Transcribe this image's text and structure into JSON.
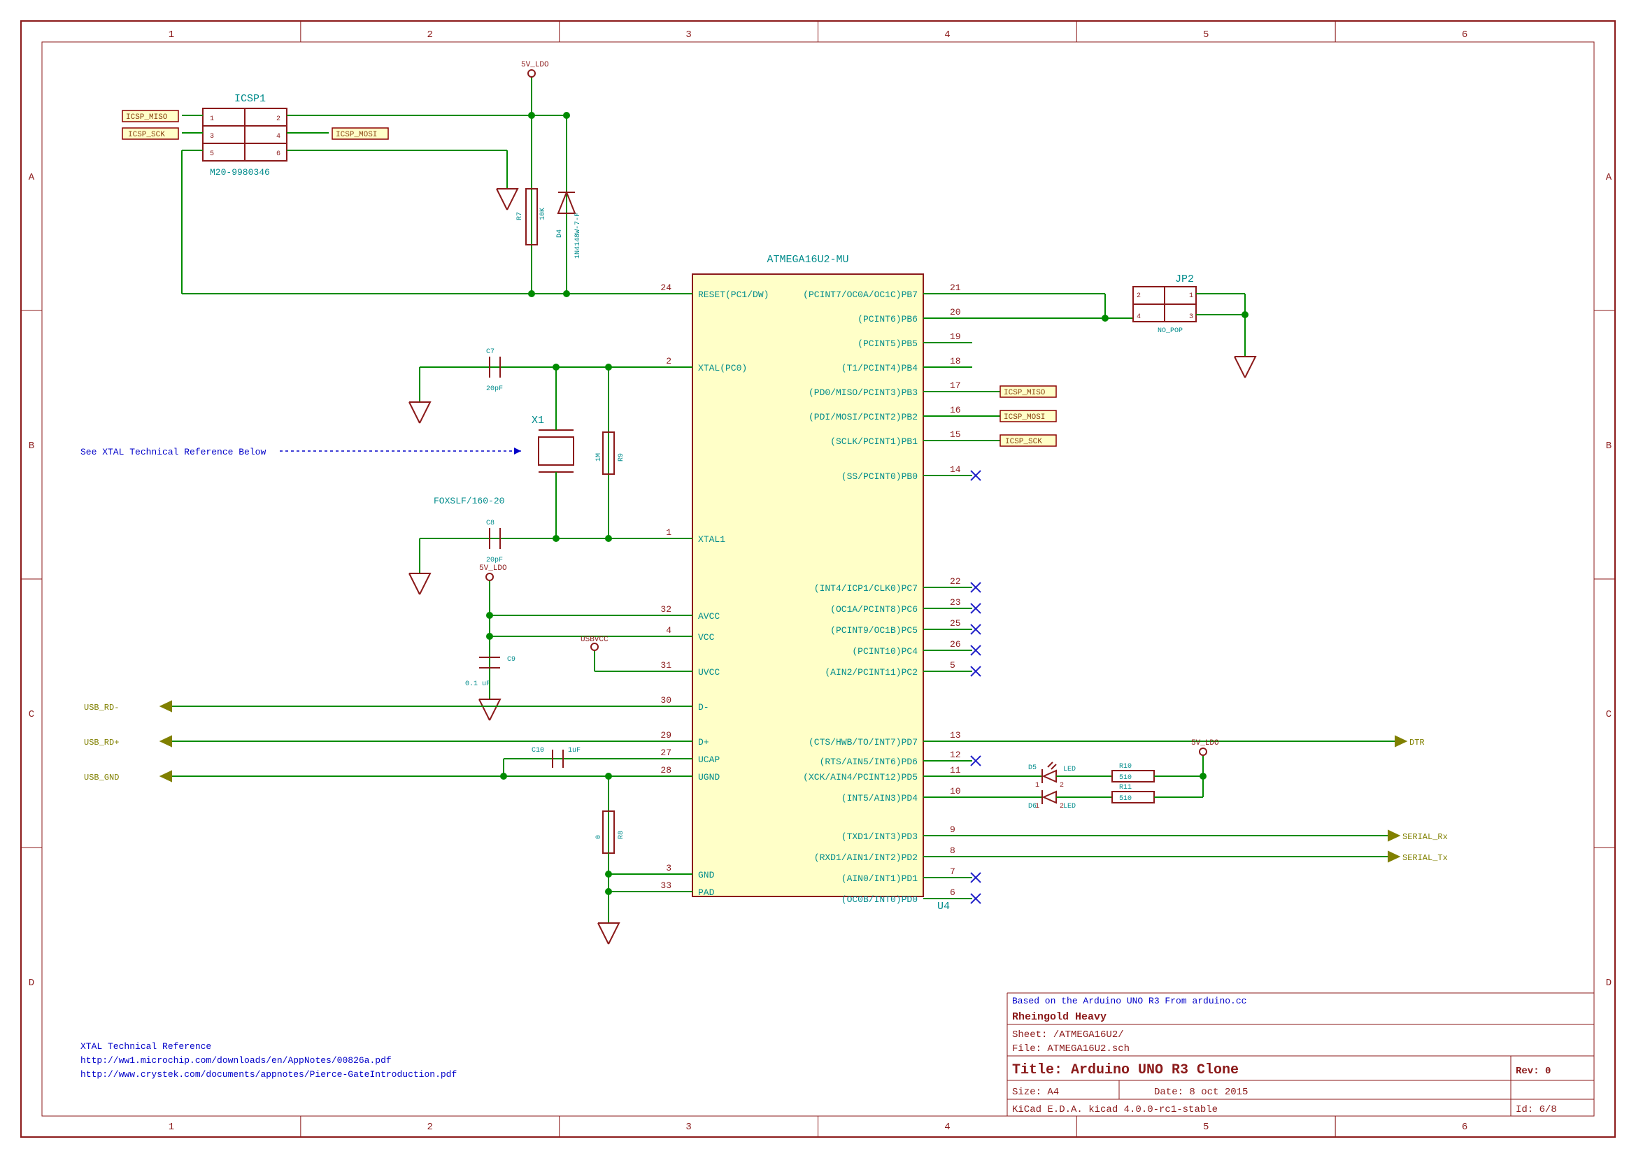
{
  "frame": {
    "cols": [
      "1",
      "2",
      "3",
      "4",
      "5",
      "6"
    ],
    "rows": [
      "A",
      "B",
      "C",
      "D"
    ]
  },
  "chip": {
    "ref": "U4",
    "name": "ATMEGA16U2-MU",
    "left_pins": [
      {
        "num": "24",
        "name": "RESET(PC1/DW)"
      },
      {
        "num": "2",
        "name": "XTAL(PC0)"
      },
      {
        "num": "1",
        "name": "XTAL1"
      },
      {
        "num": "32",
        "name": "AVCC"
      },
      {
        "num": "4",
        "name": "VCC"
      },
      {
        "num": "31",
        "name": "UVCC"
      },
      {
        "num": "30",
        "name": "D-"
      },
      {
        "num": "29",
        "name": "D+"
      },
      {
        "num": "27",
        "name": "UCAP"
      },
      {
        "num": "28",
        "name": "UGND"
      },
      {
        "num": "3",
        "name": "GND"
      },
      {
        "num": "33",
        "name": "PAD"
      }
    ],
    "right_pins": [
      {
        "num": "21",
        "name": "(PCINT7/OC0A/OC1C)PB7"
      },
      {
        "num": "20",
        "name": "(PCINT6)PB6"
      },
      {
        "num": "19",
        "name": "(PCINT5)PB5"
      },
      {
        "num": "18",
        "name": "(T1/PCINT4)PB4"
      },
      {
        "num": "17",
        "name": "(PD0/MISO/PCINT3)PB3"
      },
      {
        "num": "16",
        "name": "(PDI/MOSI/PCINT2)PB2"
      },
      {
        "num": "15",
        "name": "(SCLK/PCINT1)PB1"
      },
      {
        "num": "14",
        "name": "(SS/PCINT0)PB0"
      },
      {
        "num": "22",
        "name": "(INT4/ICP1/CLK0)PC7"
      },
      {
        "num": "23",
        "name": "(OC1A/PCINT8)PC6"
      },
      {
        "num": "25",
        "name": "(PCINT9/OC1B)PC5"
      },
      {
        "num": "26",
        "name": "(PCINT10)PC4"
      },
      {
        "num": "5",
        "name": "(AIN2/PCINT11)PC2"
      },
      {
        "num": "13",
        "name": "(CTS/HWB/TO/INT7)PD7"
      },
      {
        "num": "12",
        "name": "(RTS/AIN5/INT6)PD6"
      },
      {
        "num": "11",
        "name": "(XCK/AIN4/PCINT12)PD5"
      },
      {
        "num": "10",
        "name": "(INT5/AIN3)PD4"
      },
      {
        "num": "9",
        "name": "(TXD1/INT3)PD3"
      },
      {
        "num": "8",
        "name": "(RXD1/AIN1/INT2)PD2"
      },
      {
        "num": "7",
        "name": "(AIN0/INT1)PD1"
      },
      {
        "num": "6",
        "name": "(OC0B/INT0)PD0"
      }
    ]
  },
  "icsp": {
    "ref": "ICSP1",
    "val": "M20-9980346",
    "miso": "ICSP_MISO",
    "sck": "ICSP_SCK",
    "mosi": "ICSP_MOSI"
  },
  "jp2": {
    "ref": "JP2",
    "val": "NO_POP"
  },
  "power": {
    "v5": "5V_LDO",
    "usbvcc": "USBVCC"
  },
  "r7": {
    "ref": "R7",
    "val": "10K"
  },
  "r8": {
    "ref": "R8",
    "val": "0"
  },
  "r9": {
    "ref": "R9",
    "val": "1M"
  },
  "r10": {
    "ref": "R10",
    "val": "510"
  },
  "r11": {
    "ref": "R11",
    "val": "510"
  },
  "d4": {
    "ref": "D4",
    "val": "1N4148W-7-F"
  },
  "d5": {
    "ref": "D5",
    "val": "LED"
  },
  "d6": {
    "ref": "D6",
    "val": "LED"
  },
  "c7": {
    "ref": "C7",
    "val": "20pF"
  },
  "c8": {
    "ref": "C8",
    "val": "20pF"
  },
  "c9": {
    "ref": "C9",
    "val": "0.1 uF"
  },
  "c10": {
    "ref": "C10",
    "val": "1uF"
  },
  "x1": {
    "ref": "X1",
    "val": "FOXSLF/160-20"
  },
  "net": {
    "usb_rd_minus": "USB_RD-",
    "usb_rd_plus": "USB_RD+",
    "usb_gnd": "USB_GND",
    "dtr": "DTR",
    "serial_rx": "SERIAL_Rx",
    "serial_tx": "SERIAL_Tx"
  },
  "icsp_labels": {
    "miso": "ICSP_MISO",
    "mosi": "ICSP_MOSI",
    "sck": "ICSP_SCK"
  },
  "notes": {
    "xtal_ref": "See XTAL Technical Reference Below",
    "xtal_title": "XTAL Technical Reference",
    "link1": "http://ww1.microchip.com/downloads/en/AppNotes/00826a.pdf",
    "link2": "http://www.crystek.com/documents/appnotes/Pierce-GateIntroduction.pdf",
    "based": "Based on the Arduino UNO R3 From arduino.cc",
    "company": "Rheingold Heavy"
  },
  "titleblock": {
    "sheet": "Sheet: /ATMEGA16U2/",
    "file": "File: ATMEGA16U2.sch",
    "title": "Title: Arduino UNO R3 Clone",
    "size": "Size: A4",
    "date": "Date: 8 oct 2015",
    "rev": "Rev: 0",
    "kicad": "KiCad E.D.A.  kicad 4.0.0-rc1-stable",
    "id": "Id: 6/8"
  }
}
